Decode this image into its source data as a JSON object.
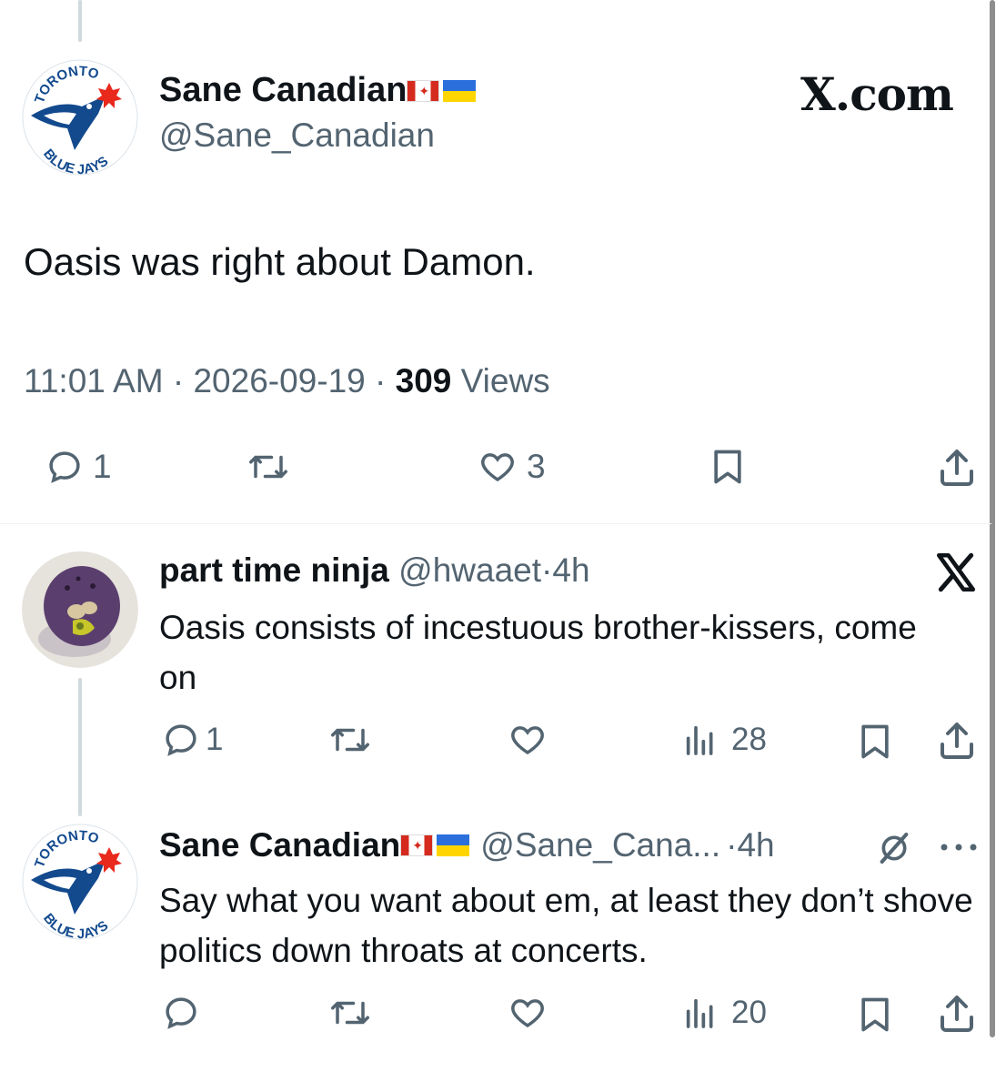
{
  "main_tweet": {
    "display_name": "Sane Canadian",
    "handle": "@Sane_Canadian",
    "site_logo": "X.com",
    "text": "Oasis was right about Damon.",
    "time": "11:01 AM",
    "date": "2026-09-19",
    "views_count": "309",
    "views_label": "Views",
    "separator": "·",
    "replies": "1",
    "likes": "3"
  },
  "reply1": {
    "display_name": "part time ninja",
    "handle": "@hwaaet",
    "age": "4h",
    "text": "Oasis consists of incestuous brother-kissers, come on",
    "replies": "1",
    "views": "28",
    "brand_icon": "x-logo-icon"
  },
  "reply2": {
    "display_name": "Sane Canadian",
    "handle": "@Sane_Cana...",
    "age": "4h",
    "text": "Say what you want about em, at least they don’t shove politics down throats at concerts.",
    "views": "20"
  },
  "avatars": {
    "sane_canadian_text_top": "TORONTO",
    "sane_canadian_text_bottom": "BLUE JAYS"
  },
  "colors": {
    "muted": "#536471",
    "text": "#0f1419",
    "thread_line": "#cfd9de",
    "jays_blue": "#134a8e",
    "jays_red": "#e8291c"
  }
}
